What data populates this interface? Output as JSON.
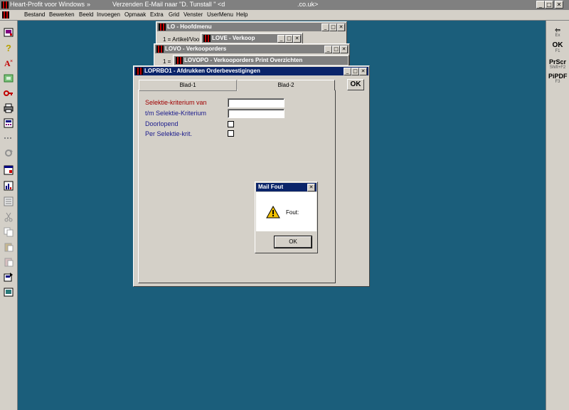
{
  "app": {
    "title": "Heart-Profit voor Windows",
    "title_arrows": "»",
    "task_title": "Verzenden E-Mail naar \"D. Tunstall \" <d",
    "task_title_end": ".co.uk>"
  },
  "menu": [
    "Bestand",
    "Bewerken",
    "Beeld",
    "Invoegen",
    "Opmaak",
    "Extra",
    "Grid",
    "Venster",
    "UserMenu",
    "Help"
  ],
  "right_toolbar": {
    "exit_sub": "Ex",
    "ok_label": "OK",
    "ok_sub": "F1",
    "prscr_label": "PrScr",
    "prscr_sub": "Shift+F2",
    "pipdf_label": "PiPDF",
    "pipdf_sub": "F3"
  },
  "windows": {
    "lo": {
      "title": "LO - Hoofdmenu",
      "row": "1 = Artikel/Voo"
    },
    "love": {
      "title": "LOVE - Verkoop"
    },
    "lovo": {
      "title": "LOVO - Verkooporders",
      "row": "1 ="
    },
    "lovopo": {
      "title": "LOVOPO - Verkooporders Print Overzichten"
    },
    "loprbo1": {
      "title": "LOPRBO1 - Afdrukken Orderbevestigingen"
    }
  },
  "form": {
    "tabs": [
      "Blad-1",
      "Blad-2"
    ],
    "ok_button": "OK",
    "fields": {
      "selectie_van": {
        "label": "Selektie-kriterium van",
        "value": ""
      },
      "selectie_tm": {
        "label": "t/m Selektie-Kriterium",
        "value": ""
      },
      "doorlopend": {
        "label": "Doorlopend"
      },
      "per_selektie": {
        "label": "Per Selektie-krit."
      }
    }
  },
  "dialog": {
    "title": "Mail Fout",
    "message": "Fout:",
    "ok": "OK",
    "close": "✕"
  },
  "colors": {
    "desktop": "#1b5e7b",
    "active_title": "#0a246a",
    "label_red": "#a00000",
    "label_blue": "#1a1a8c"
  }
}
